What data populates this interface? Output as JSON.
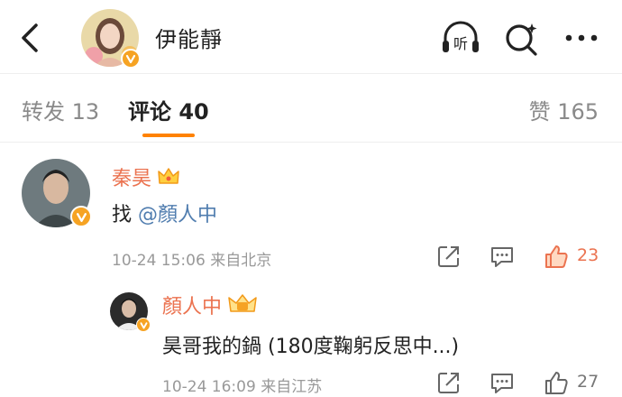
{
  "header": {
    "title": "伊能靜",
    "listen_label": "听"
  },
  "tabs": {
    "repost": "转发 13",
    "comment": "评论 40",
    "like": "赞 165"
  },
  "comments": [
    {
      "name": "秦昊",
      "text_prefix": "找 ",
      "mention": "@顏人中",
      "meta": "10-24 15:06 来自北京",
      "likes": "23",
      "liked": true
    },
    {
      "name": "顏人中",
      "text": "昊哥我的鍋 (180度鞠躬反思中...)",
      "meta": "10-24 16:09 来自江苏",
      "likes": "27",
      "liked": false
    }
  ],
  "colors": {
    "accent": "#ff8200",
    "name": "#eb7350",
    "mention": "#507daf",
    "verified": "#f6a323"
  }
}
